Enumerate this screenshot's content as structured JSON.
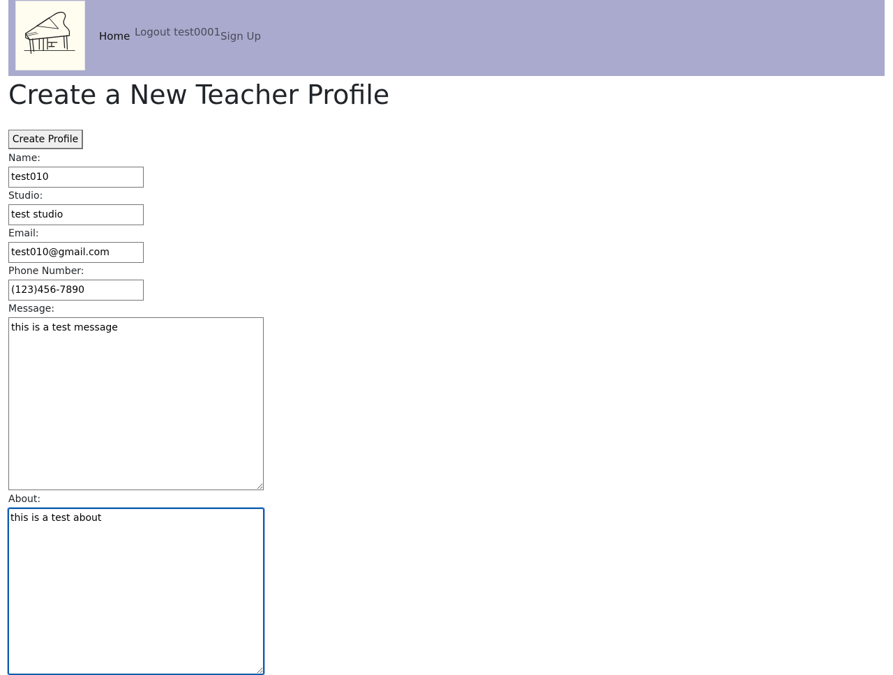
{
  "nav": {
    "logo_icon": "grand-piano-icon",
    "home": "Home",
    "logout": "Logout test0001",
    "signup": "Sign Up",
    "background_color": "#a9aacd"
  },
  "page": {
    "title": "Create a New Teacher Profile"
  },
  "form": {
    "submit_label": "Create Profile",
    "name": {
      "label": "Name:",
      "value": "test010"
    },
    "studio": {
      "label": "Studio:",
      "value": "test studio"
    },
    "email": {
      "label": "Email:",
      "value": "test010@gmail.com"
    },
    "phone": {
      "label": "Phone Number:",
      "value": "(123)456-7890"
    },
    "message": {
      "label": "Message:",
      "value": "this is a test message"
    },
    "about": {
      "label": "About:",
      "value": "this is a test about"
    }
  }
}
